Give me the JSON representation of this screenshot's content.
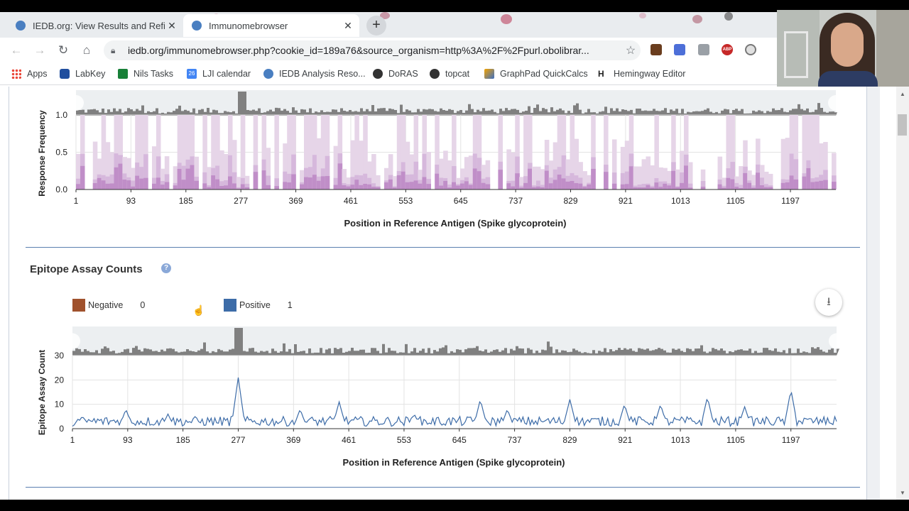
{
  "browser": {
    "tabs": [
      {
        "title": "IEDB.org: View Results and Refine",
        "active": false
      },
      {
        "title": "Immunomebrowser",
        "active": true
      }
    ],
    "new_tab_label": "+",
    "url": "iedb.org/immunomebrowser.php?cookie_id=189a76&source_organism=http%3A%2F%2Fpurl.obolibrar...",
    "bookmarks": [
      "Apps",
      "LabKey",
      "Nils Tasks",
      "LJI calendar",
      "IEDB Analysis Reso...",
      "DoRAS",
      "topcat",
      "GraphPad QuickCalcs",
      "Hemingway Editor"
    ],
    "calendar_day": "26",
    "hemingway_glyph": "H",
    "extension_label": "ABP"
  },
  "colors": {
    "negative": "#a0522d",
    "positive": "#3d6ca8",
    "response_light": "#e6d5e8",
    "response_mid": "#d6b8dc",
    "response_dark": "#c08ec8",
    "overview": "#808080"
  },
  "response_chart": {
    "ylabel": "Response Frequency",
    "xlabel": "Position in Reference Antigen (Spike glycoprotein)"
  },
  "assay_section": {
    "title": "Epitope Assay Counts",
    "help_icon_text": "?",
    "legend": [
      {
        "label": "Negative",
        "count": "0"
      },
      {
        "label": "Positive",
        "count": "1"
      }
    ]
  },
  "assay_chart": {
    "ylabel": "Epitope Assay Count",
    "xlabel": "Position in Reference Antigen (Spike glycoprotein)"
  },
  "chart_data": [
    {
      "type": "area",
      "ylabel": "Response Frequency",
      "xlabel": "Position in Reference Antigen (Spike glycoprotein)",
      "ylim": [
        0,
        1.0
      ],
      "xlim": [
        1,
        1273
      ],
      "y_ticks": [
        "0.0",
        "0.5",
        "1.0"
      ],
      "x_ticks": [
        "1",
        "93",
        "185",
        "277",
        "369",
        "461",
        "553",
        "645",
        "737",
        "829",
        "921",
        "1013",
        "1105",
        "1197"
      ],
      "grid": true
    },
    {
      "type": "line",
      "ylabel": "Epitope Assay Count",
      "xlabel": "Position in Reference Antigen (Spike glycoprotein)",
      "ylim": [
        0,
        30
      ],
      "xlim": [
        1,
        1273
      ],
      "y_ticks": [
        "0",
        "10",
        "20",
        "30"
      ],
      "x_ticks": [
        "1",
        "93",
        "185",
        "277",
        "369",
        "461",
        "553",
        "645",
        "737",
        "829",
        "921",
        "1013",
        "1105",
        "1197"
      ],
      "grid": true,
      "series": [
        {
          "name": "Positive"
        }
      ]
    }
  ]
}
